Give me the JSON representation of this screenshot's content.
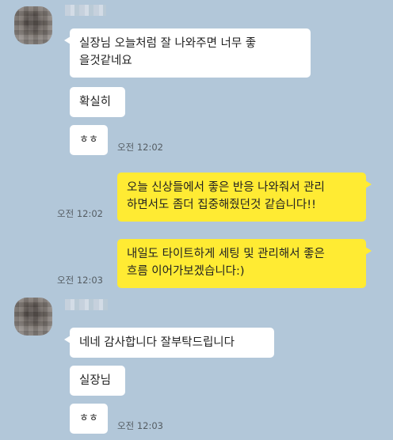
{
  "messages": [
    {
      "text": "실장님 오늘처럼 잘 나와주면 너무 좋\n을것같네요"
    },
    {
      "text": "확실히"
    },
    {
      "text": "ㅎㅎ",
      "time": "오전 12:02"
    },
    {
      "text": "오늘 신상들에서 좋은 반응 나와줘서 관리\n하면서도 좀더 집중해줬던것 같습니다!!",
      "time": "오전 12:02"
    },
    {
      "text": "내일도 타이트하게 세팅 및 관리해서 좋은\n흐름 이어가보겠습니다:)",
      "time": "오전 12:03"
    },
    {
      "text": "네네 감사합니다 잘부탁드립니다"
    },
    {
      "text": "실장님"
    },
    {
      "text": "ㅎㅎ",
      "time": "오전 12:03"
    }
  ]
}
